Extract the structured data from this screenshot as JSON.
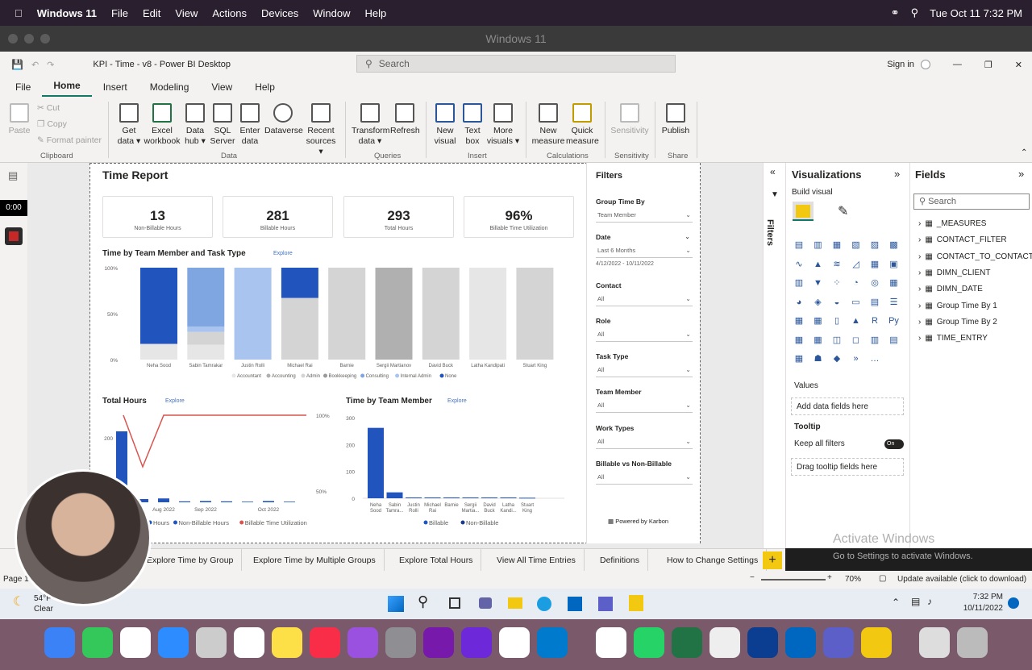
{
  "mac_menu": {
    "app": "Windows 11",
    "items": [
      "File",
      "Edit",
      "View",
      "Actions",
      "Devices",
      "Window",
      "Help"
    ],
    "clock": "Tue Oct 11  7:32 PM"
  },
  "vm_title": "Windows 11",
  "window": {
    "title": "KPI - Time - v8 - Power BI Desktop",
    "search_placeholder": "Search",
    "sign_in": "Sign in"
  },
  "ribbon_tabs": [
    "File",
    "Home",
    "Insert",
    "Modeling",
    "View",
    "Help"
  ],
  "ribbon": {
    "clipboard": {
      "paste": "Paste",
      "cut": "Cut",
      "copy": "Copy",
      "format_painter": "Format painter",
      "group": "Clipboard"
    },
    "data": {
      "get_data": "Get data",
      "excel": "Excel workbook",
      "data_hub": "Data hub",
      "sql": "SQL Server",
      "enter": "Enter data",
      "dataverse": "Dataverse",
      "recent": "Recent sources",
      "group": "Data"
    },
    "queries": {
      "transform": "Transform data",
      "refresh": "Refresh",
      "group": "Queries"
    },
    "insert": {
      "new_visual": "New visual",
      "text_box": "Text box",
      "more_visuals": "More visuals",
      "group": "Insert"
    },
    "calculations": {
      "new_measure": "New measure",
      "quick_measure": "Quick measure",
      "group": "Calculations"
    },
    "sensitivity": {
      "label": "Sensitivity",
      "group": "Sensitivity"
    },
    "share": {
      "publish": "Publish",
      "group": "Share"
    }
  },
  "timer": "0:00",
  "report": {
    "title": "Time Report",
    "kpis": [
      {
        "value": "13",
        "label": "Non-Billable Hours"
      },
      {
        "value": "281",
        "label": "Billable Hours"
      },
      {
        "value": "293",
        "label": "Total Hours"
      },
      {
        "value": "96%",
        "label": "Billable Time Utilization"
      }
    ],
    "explore": "Explore",
    "powered_by": "Powered by Karbon"
  },
  "chart_data": [
    {
      "type": "bar",
      "title": "Time by Team Member and Task Type",
      "stacked": "100%",
      "categories": [
        "Neha Sood",
        "Sabin Tamrakar",
        "Justin Rolli",
        "Michael Rai",
        "Barnie",
        "Sergii Martianov",
        "David Buck",
        "Latha Kandipati",
        "Stuart King"
      ],
      "yticks": [
        "100%",
        "50%",
        "0%"
      ],
      "legend": [
        "Accountant",
        "Accounting",
        "Admin",
        "Bookkeeping",
        "Consulting",
        "Internal Admin",
        "None"
      ],
      "series_colors": {
        "None": "#2155bd",
        "Internal Admin": "#a9c4ee",
        "Consulting": "#7fa6e0",
        "Admin": "#d4d4d4",
        "Accounting": "#b0b0b0",
        "Accountant": "#e6e6e6"
      },
      "stacks": [
        [
          {
            "s": "None",
            "v": 83
          },
          {
            "s": "Accountant",
            "v": 17
          }
        ],
        [
          {
            "s": "Consulting",
            "v": 64
          },
          {
            "s": "Internal Admin",
            "v": 6
          },
          {
            "s": "Admin",
            "v": 14
          },
          {
            "s": "Accountant",
            "v": 16
          }
        ],
        [
          {
            "s": "Internal Admin",
            "v": 100
          }
        ],
        [
          {
            "s": "None",
            "v": 33
          },
          {
            "s": "Admin",
            "v": 67
          }
        ],
        [
          {
            "s": "Admin",
            "v": 100
          }
        ],
        [
          {
            "s": "Accounting",
            "v": 100
          }
        ],
        [
          {
            "s": "Admin",
            "v": 100
          }
        ],
        [
          {
            "s": "Accountant",
            "v": 100
          }
        ],
        [
          {
            "s": "Admin",
            "v": 100
          }
        ]
      ]
    },
    {
      "type": "bar+line",
      "title": "Total Hours",
      "categories": [
        "",
        "",
        "Aug 2022",
        "",
        "Sep 2022",
        "",
        "",
        "Oct 2022",
        ""
      ],
      "bars": [
        220,
        10,
        12,
        3,
        4,
        3,
        2,
        4,
        2
      ],
      "line": [
        100,
        60,
        100,
        100,
        100,
        100,
        100,
        100,
        100
      ],
      "yticks_left": [
        "200"
      ],
      "yticks_right": [
        "100%",
        "50%"
      ],
      "legend": [
        "Hours",
        "Non-Billable Hours",
        "Billable Time Utilization"
      ]
    },
    {
      "type": "bar",
      "title": "Time by Team Member",
      "stacked": true,
      "categories": [
        "Neha Sood",
        "Sabin Tamra...",
        "Justin Rolli",
        "Michael Rai",
        "Barnie",
        "Sergii Martia...",
        "David Buck",
        "Latha Kandi...",
        "Stuart King"
      ],
      "billable": [
        262,
        22,
        3,
        3,
        3,
        3,
        3,
        3,
        2
      ],
      "non_billable": [
        0,
        0,
        0,
        0,
        0,
        0,
        0,
        0,
        0
      ],
      "ylim": [
        0,
        300
      ],
      "yticks": [
        "300",
        "200",
        "100",
        "0"
      ],
      "legend": [
        "Billable",
        "Non-Billable"
      ]
    }
  ],
  "filters": {
    "title": "Filters",
    "items": [
      {
        "label": "Group Time By",
        "value": "Team Member"
      },
      {
        "label": "Date",
        "value": "Last   6   Months",
        "range": "4/12/2022 - 10/11/2022"
      },
      {
        "label": "Contact",
        "value": "All"
      },
      {
        "label": "Role",
        "value": "All"
      },
      {
        "label": "Task Type",
        "value": "All"
      },
      {
        "label": "Team Member",
        "value": "All"
      },
      {
        "label": "Work Types",
        "value": "All"
      },
      {
        "label": "Billable vs Non-Billable",
        "value": "All"
      }
    ]
  },
  "filters_pane_label": "Filters",
  "visualizations": {
    "title": "Visualizations",
    "build": "Build visual",
    "values": "Values",
    "add_fields": "Add data fields here",
    "tooltip": "Tooltip",
    "keep_filters": "Keep all filters",
    "toggle": "On",
    "tooltip_fields": "Drag tooltip fields here"
  },
  "fields_pane": {
    "title": "Fields",
    "search": "Search",
    "tables": [
      "_MEASURES",
      "CONTACT_FILTER",
      "CONTACT_TO_CONTACT",
      "DIMN_CLIENT",
      "DIMN_DATE",
      "Group Time By 1",
      "Group Time By 2",
      "TIME_ENTRY"
    ]
  },
  "page_tabs": [
    "Explore Time by Group",
    "Explore Time by Multiple Groups",
    "Explore Total Hours",
    "View All Time Entries",
    "Definitions",
    "How to Change Settings"
  ],
  "status": {
    "page": "Page 1",
    "zoom": "70%",
    "update": "Update available (click to download)"
  },
  "activate": {
    "title": "Activate Windows",
    "sub": "Go to Settings to activate Windows."
  },
  "weather": {
    "temp": "54°F",
    "desc": "Clear"
  },
  "win_clock": {
    "time": "7:32 PM",
    "date": "10/11/2022"
  }
}
